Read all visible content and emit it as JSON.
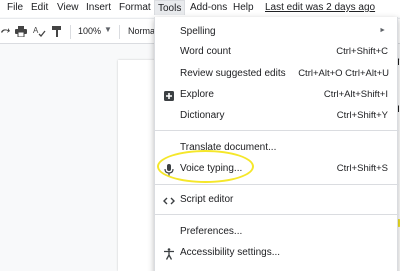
{
  "menubar": {
    "items": [
      "File",
      "Edit",
      "View",
      "Insert",
      "Format",
      "Tools",
      "Add-ons",
      "Help"
    ],
    "last_edit": "Last edit was 2 days ago"
  },
  "toolbar": {
    "zoom": "100%",
    "style": "Normal"
  },
  "tools_menu": {
    "items": [
      {
        "label": "Spelling",
        "shortcut": "",
        "submenu": true,
        "icon": ""
      },
      {
        "label": "Word count",
        "shortcut": "Ctrl+Shift+C",
        "icon": ""
      },
      {
        "label": "Review suggested edits",
        "shortcut": "Ctrl+Alt+O Ctrl+Alt+U",
        "icon": ""
      },
      {
        "label": "Explore",
        "shortcut": "Ctrl+Alt+Shift+I",
        "icon": "explore-icon"
      },
      {
        "label": "Dictionary",
        "shortcut": "Ctrl+Shift+Y",
        "icon": ""
      },
      {
        "label": "Translate document...",
        "shortcut": "",
        "icon": ""
      },
      {
        "label": "Voice typing...",
        "shortcut": "Ctrl+Shift+S",
        "icon": "microphone-icon"
      },
      {
        "label": "Script editor",
        "shortcut": "",
        "icon": "code-icon"
      },
      {
        "label": "Preferences...",
        "shortcut": "",
        "icon": ""
      },
      {
        "label": "Accessibility settings...",
        "shortcut": "",
        "icon": "accessibility-icon"
      }
    ],
    "submenu_arrow": "►"
  },
  "accent": {
    "highlight": "#f5e72a"
  }
}
